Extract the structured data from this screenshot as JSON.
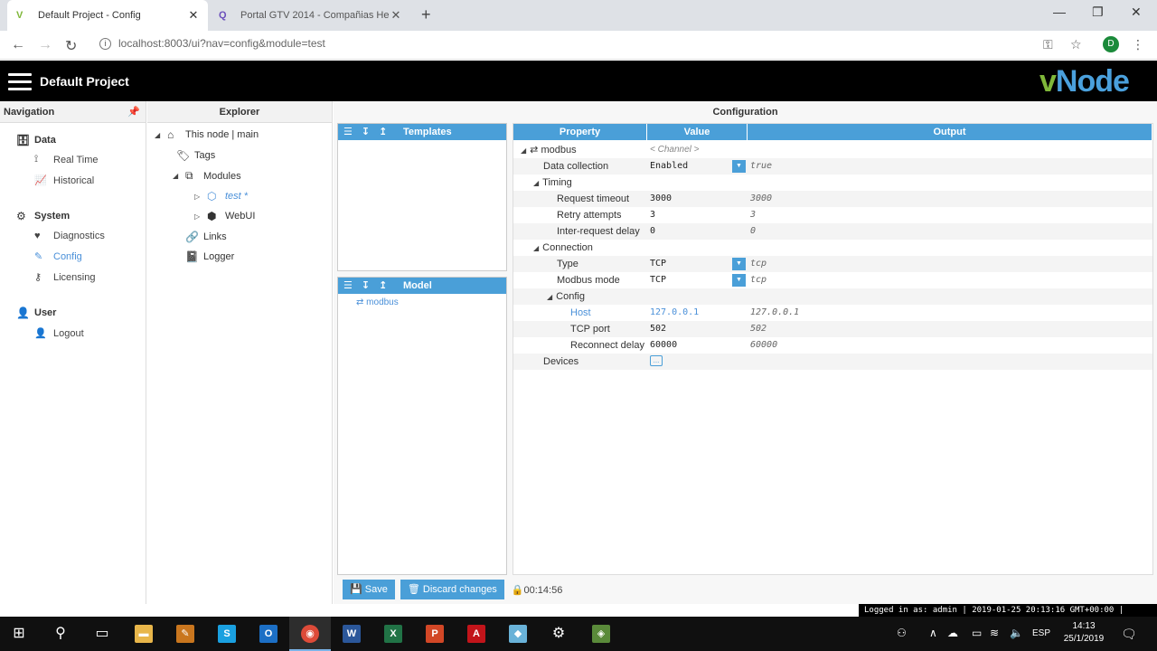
{
  "browser": {
    "tabs": [
      {
        "title": "Default Project - Config"
      },
      {
        "title": "Portal GTV 2014 - Compañias He"
      }
    ],
    "url": "localhost:8003/ui?nav=config&module=test",
    "profile_initial": "D"
  },
  "app": {
    "title": "Default Project",
    "logo_v": "v",
    "logo_rest": "Node"
  },
  "navigation": {
    "title": "Navigation",
    "groups": [
      {
        "label": "Data",
        "items": [
          {
            "label": "Real Time"
          },
          {
            "label": "Historical"
          }
        ]
      },
      {
        "label": "System",
        "items": [
          {
            "label": "Diagnostics"
          },
          {
            "label": "Config"
          },
          {
            "label": "Licensing"
          }
        ]
      },
      {
        "label": "User",
        "items": [
          {
            "label": "Logout"
          }
        ]
      }
    ]
  },
  "explorer": {
    "title": "Explorer",
    "root": "This node | main",
    "tags": "Tags",
    "modules": "Modules",
    "test": "test *",
    "webui": "WebUI",
    "links": "Links",
    "logger": "Logger"
  },
  "configuration": {
    "title": "Configuration",
    "templates_label": "Templates",
    "model_label": "Model",
    "model_item": "modbus",
    "headers": {
      "property": "Property",
      "value": "Value",
      "output": "Output"
    },
    "rows": [
      {
        "property": "modbus",
        "value": "< Channel >",
        "output": ""
      },
      {
        "property": "Data collection",
        "value": "Enabled",
        "output": "true"
      },
      {
        "property": "Timing",
        "value": "",
        "output": ""
      },
      {
        "property": "Request timeout",
        "value": "3000",
        "output": "3000"
      },
      {
        "property": "Retry attempts",
        "value": "3",
        "output": "3"
      },
      {
        "property": "Inter-request delay",
        "value": "0",
        "output": "0"
      },
      {
        "property": "Connection",
        "value": "",
        "output": ""
      },
      {
        "property": "Type",
        "value": "TCP",
        "output": "tcp"
      },
      {
        "property": "Modbus mode",
        "value": "TCP",
        "output": "tcp"
      },
      {
        "property": "Config",
        "value": "",
        "output": ""
      },
      {
        "property": "Host",
        "value": "127.0.0.1",
        "output": "127.0.0.1"
      },
      {
        "property": "TCP port",
        "value": "502",
        "output": "502"
      },
      {
        "property": "Reconnect delay",
        "value": "60000",
        "output": "60000"
      },
      {
        "property": "Devices",
        "value": "...",
        "output": ""
      }
    ],
    "save_label": "Save",
    "discard_label": "Discard changes",
    "timer": "00:14:56"
  },
  "status": {
    "logged_in": "Logged in as: admin | 2019-01-25 20:13:16 GMT+00:00 |"
  },
  "taskbar": {
    "lang": "ESP",
    "time": "14:13",
    "date": "25/1/2019"
  }
}
